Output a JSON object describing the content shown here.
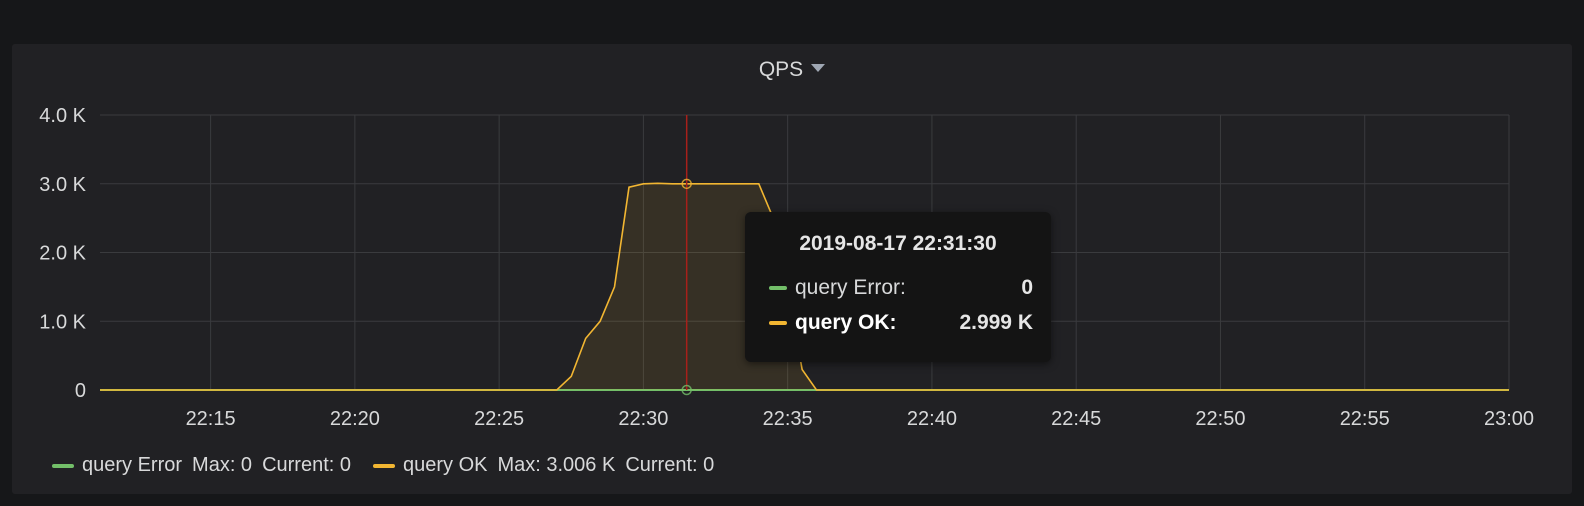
{
  "panel": {
    "title": "QPS"
  },
  "colors": {
    "error": "#73bf69",
    "ok": "#fade2a",
    "ok_line": "#f2b632",
    "crosshair": "#a8201a",
    "grid": "#3a3b3e",
    "background": "#212124"
  },
  "chart_data": {
    "type": "area",
    "x_tick_labels": [
      "22:15",
      "22:20",
      "22:25",
      "22:30",
      "22:35",
      "22:40",
      "22:45",
      "22:50",
      "22:55",
      "23:00"
    ],
    "y_tick_labels": [
      "0",
      "1.0 K",
      "2.0 K",
      "3.0 K",
      "4.0 K"
    ],
    "ylim": [
      0,
      4000
    ],
    "xlim": [
      "22:11:10",
      "23:00:00"
    ],
    "grid": true,
    "legend_position": "bottom-left",
    "series": [
      {
        "name": "query Error",
        "color": "#73bf69",
        "x": [
          "22:11:10",
          "23:00:00"
        ],
        "values": [
          0,
          0
        ],
        "max": "0",
        "current": "0"
      },
      {
        "name": "query OK",
        "color": "#f2b632",
        "x": [
          "22:11:10",
          "22:27:00",
          "22:27:30",
          "22:28:00",
          "22:28:30",
          "22:29:00",
          "22:29:30",
          "22:30:00",
          "22:30:30",
          "22:31:00",
          "22:31:30",
          "22:32:00",
          "22:32:30",
          "22:33:00",
          "22:33:30",
          "22:34:00",
          "22:34:30",
          "22:35:00",
          "22:35:30",
          "22:36:00",
          "23:00:00"
        ],
        "values": [
          0,
          0,
          200,
          750,
          1000,
          1500,
          2950,
          3000,
          3006,
          3000,
          2999,
          3000,
          3000,
          3000,
          3000,
          3000,
          2500,
          1500,
          300,
          0,
          0
        ],
        "max": "3.006 K",
        "current": "0"
      }
    ],
    "crosshair_time": "22:31:30"
  },
  "legend": {
    "error": {
      "name": "query Error",
      "max": "Max: 0",
      "current": "Current: 0"
    },
    "ok": {
      "name": "query OK",
      "max": "Max: 3.006 K",
      "current": "Current: 0"
    }
  },
  "tooltip": {
    "title": "2019-08-17 22:31:30",
    "rows": [
      {
        "name": "query Error:",
        "value": "0"
      },
      {
        "name": "query OK:",
        "value": "2.999 K"
      }
    ]
  }
}
